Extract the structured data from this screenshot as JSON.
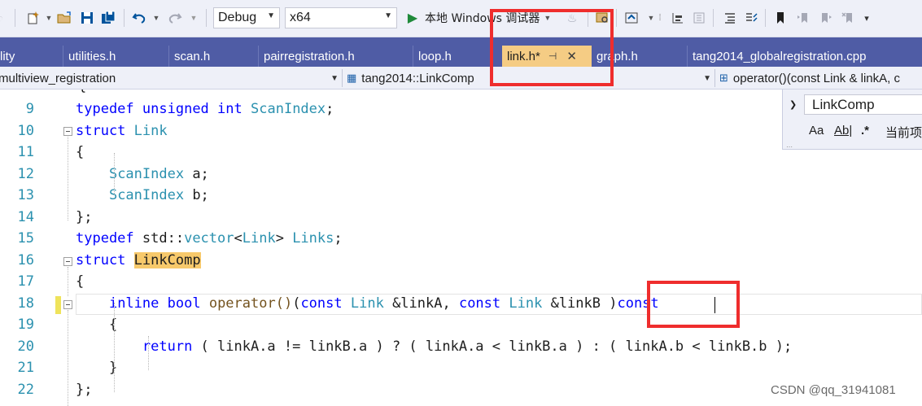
{
  "toolbar": {
    "icons": [
      "new-project-icon",
      "open-folder-icon",
      "save-icon",
      "save-all-icon",
      "undo-icon",
      "redo-icon",
      "start-debug-icon",
      "hot-reload-icon",
      "browse-icon",
      "comment-icon"
    ],
    "configuration": "Debug",
    "platform": "x64",
    "debugger_label": "本地 Windows 调试器"
  },
  "tabs": [
    {
      "label": "lity"
    },
    {
      "label": "utilities.h"
    },
    {
      "label": "scan.h"
    },
    {
      "label": "pairregistration.h"
    },
    {
      "label": "loop.h"
    },
    {
      "label": "link.h*",
      "active": true,
      "pin": "⊣",
      "close": "✕"
    },
    {
      "label": "graph.h"
    },
    {
      "label": "tang2014_globalregistration.cpp"
    }
  ],
  "navbar": {
    "project": "multiview_registration",
    "scope": "tang2014::LinkComp",
    "member": "operator()(const Link & linkA, c"
  },
  "find": {
    "query": "LinkComp",
    "match_case": "Aa",
    "whole_word": "Ab|",
    "regex": ".*",
    "scope": "当前项"
  },
  "editor": {
    "lines": [
      {
        "n": "9",
        "tokens": [
          {
            "t": "kw",
            "v": "typedef"
          },
          {
            "t": "p",
            "v": " "
          },
          {
            "t": "kw",
            "v": "unsigned"
          },
          {
            "t": "p",
            "v": " "
          },
          {
            "t": "kw",
            "v": "int"
          },
          {
            "t": "p",
            "v": " "
          },
          {
            "t": "ty",
            "v": "ScanIndex"
          },
          {
            "t": "p",
            "v": ";"
          }
        ]
      },
      {
        "n": "10",
        "tokens": [
          {
            "t": "kw",
            "v": "struct"
          },
          {
            "t": "p",
            "v": " "
          },
          {
            "t": "ty",
            "v": "Link"
          }
        ]
      },
      {
        "n": "11",
        "tokens": [
          {
            "t": "p",
            "v": "{"
          }
        ]
      },
      {
        "n": "12",
        "tokens": [
          {
            "t": "p",
            "v": "    "
          },
          {
            "t": "ty",
            "v": "ScanIndex"
          },
          {
            "t": "p",
            "v": " a;"
          }
        ]
      },
      {
        "n": "13",
        "tokens": [
          {
            "t": "p",
            "v": "    "
          },
          {
            "t": "ty",
            "v": "ScanIndex"
          },
          {
            "t": "p",
            "v": " b;"
          }
        ]
      },
      {
        "n": "14",
        "tokens": [
          {
            "t": "p",
            "v": "};"
          }
        ]
      },
      {
        "n": "15",
        "tokens": [
          {
            "t": "kw",
            "v": "typedef"
          },
          {
            "t": "p",
            "v": " std::"
          },
          {
            "t": "ty",
            "v": "vector"
          },
          {
            "t": "p",
            "v": "<"
          },
          {
            "t": "ty",
            "v": "Link"
          },
          {
            "t": "p",
            "v": "> "
          },
          {
            "t": "ty",
            "v": "Links"
          },
          {
            "t": "p",
            "v": ";"
          }
        ]
      },
      {
        "n": "16",
        "tokens": [
          {
            "t": "kw",
            "v": "struct"
          },
          {
            "t": "p",
            "v": " "
          },
          {
            "t": "hl",
            "v": "LinkComp"
          }
        ]
      },
      {
        "n": "17",
        "tokens": [
          {
            "t": "p",
            "v": "{"
          }
        ]
      },
      {
        "n": "18",
        "tokens": [
          {
            "t": "p",
            "v": "    "
          },
          {
            "t": "kw",
            "v": "inline"
          },
          {
            "t": "p",
            "v": " "
          },
          {
            "t": "kw",
            "v": "bool"
          },
          {
            "t": "p",
            "v": " "
          },
          {
            "t": "fn",
            "v": "operator()"
          },
          {
            "t": "p",
            "v": "("
          },
          {
            "t": "kw",
            "v": "const"
          },
          {
            "t": "p",
            "v": " "
          },
          {
            "t": "ty",
            "v": "Link"
          },
          {
            "t": "p",
            "v": " &linkA, "
          },
          {
            "t": "kw",
            "v": "const"
          },
          {
            "t": "p",
            "v": " "
          },
          {
            "t": "ty",
            "v": "Link"
          },
          {
            "t": "p",
            "v": " &linkB )"
          },
          {
            "t": "kw",
            "v": "const"
          }
        ]
      },
      {
        "n": "19",
        "tokens": [
          {
            "t": "p",
            "v": "    {"
          }
        ]
      },
      {
        "n": "20",
        "tokens": [
          {
            "t": "p",
            "v": "        "
          },
          {
            "t": "kw",
            "v": "return"
          },
          {
            "t": "p",
            "v": " ( linkA.a != linkB.a ) ? ( linkA.a < linkB.a ) : ( linkA.b < linkB.b );"
          }
        ]
      },
      {
        "n": "21",
        "tokens": [
          {
            "t": "p",
            "v": "    }"
          }
        ]
      },
      {
        "n": "22",
        "tokens": [
          {
            "t": "p",
            "v": "};"
          }
        ]
      }
    ]
  },
  "watermark": "CSDN @qq_31941081"
}
